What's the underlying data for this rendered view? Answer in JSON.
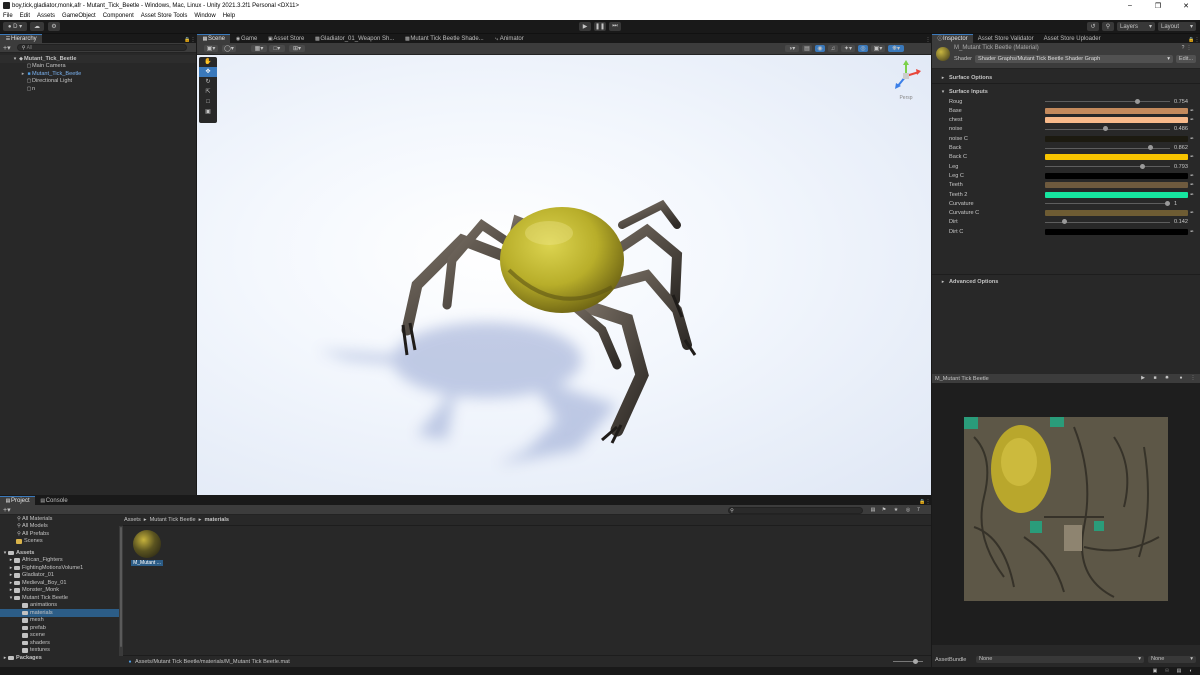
{
  "window": {
    "title": "boy,tick,gladiator,monk,afr - Mutant_Tick_Beetle - Windows, Mac, Linux - Unity 2021.3.2f1 Personal <DX11>"
  },
  "menu": [
    "File",
    "Edit",
    "Assets",
    "GameObject",
    "Component",
    "Asset Store Tools",
    "Window",
    "Help"
  ],
  "toolbar": {
    "account": "D",
    "layers": "Layers",
    "layout": "Layout"
  },
  "hierarchy": {
    "tab": "Hierarchy",
    "search_placeholder": "All",
    "items": [
      {
        "label": "Mutant_Tick_Beetle",
        "indent": 1,
        "scene": true
      },
      {
        "label": "Main Camera",
        "indent": 2
      },
      {
        "label": "Mutant_Tick_Beetle",
        "indent": 2,
        "prefab": true
      },
      {
        "label": "Directional Light",
        "indent": 2
      },
      {
        "label": "n",
        "indent": 2
      }
    ]
  },
  "scene": {
    "tabs": [
      "Scene",
      "Game",
      "Asset Store",
      "Gladiator_01_Weapon Sh...",
      "Mutant Tick Beetle Shade...",
      "Animator"
    ],
    "active_tab": 0,
    "persp": "Persp"
  },
  "inspector": {
    "tabs": [
      "Inspector",
      "Asset Store Validator",
      "Asset Store Uploader"
    ],
    "material": "M_Mutant Tick Beetle (Material)",
    "shader_label": "Shader",
    "shader": "Shader Graphs/Mutant Tick Beetle Shader Graph",
    "edit": "Edit...",
    "surface_options": "Surface Options",
    "surface_inputs": "Surface Inputs",
    "advanced_options": "Advanced Options",
    "properties": [
      {
        "name": "Roug",
        "kind": "slider",
        "value": "0.754",
        "v": 0.754
      },
      {
        "name": "Base",
        "kind": "color",
        "color": "#c48a5c"
      },
      {
        "name": "chest",
        "kind": "color",
        "color": "#f7b98a"
      },
      {
        "name": "noise",
        "kind": "slider",
        "value": "0.486",
        "v": 0.486
      },
      {
        "name": "noise C",
        "kind": "color",
        "color": "#1c1a10"
      },
      {
        "name": "Back",
        "kind": "slider",
        "value": "0.862",
        "v": 0.862
      },
      {
        "name": "Back C",
        "kind": "color",
        "color": "#f7c400"
      },
      {
        "name": "Leg",
        "kind": "slider",
        "value": "0.793",
        "v": 0.793
      },
      {
        "name": "Leg C",
        "kind": "color",
        "color": "#000000"
      },
      {
        "name": "Teeth",
        "kind": "color",
        "color": "#6e5a3e"
      },
      {
        "name": "Teeth 2",
        "kind": "color",
        "color": "#16e6a0"
      },
      {
        "name": "Curvature",
        "kind": "slider",
        "value": "1",
        "v": 1
      },
      {
        "name": "Curvature C",
        "kind": "color",
        "color": "#6e5c33"
      },
      {
        "name": "Dirt",
        "kind": "slider",
        "value": "0.142",
        "v": 0.142
      },
      {
        "name": "Dirt C",
        "kind": "color",
        "color": "#000000"
      }
    ],
    "preview_title": "M_Mutant Tick Beetle",
    "assetbundle_label": "AssetBundle",
    "assetbundle_value": "None",
    "assetbundle_variant": "None"
  },
  "project": {
    "tabs": [
      "Project",
      "Console"
    ],
    "favorites": [
      "All Materials",
      "All Models",
      "All Prefabs",
      "Scenes"
    ],
    "assets_label": "Assets",
    "tree": [
      "African_Fighters",
      "FightingMotionsVolume1",
      "Gladiator_01",
      "Medieval_Boy_01",
      "Monster_Monk",
      "Mutant Tick Beetle"
    ],
    "subtree": [
      "animations",
      "materials",
      "mesh",
      "prefab",
      "scene",
      "shaders",
      "textures"
    ],
    "packages_label": "Packages",
    "breadcrumb": [
      "Assets",
      "Mutant Tick Beetle",
      "materials"
    ],
    "asset_name": "M_Mutant ...",
    "path": "Assets/Mutant Tick Beetle/materials/M_Mutant Tick Beetle.mat",
    "count": "7"
  },
  "colors": {
    "accent": "#3a79bb",
    "panel": "#282828",
    "dark": "#191919"
  }
}
